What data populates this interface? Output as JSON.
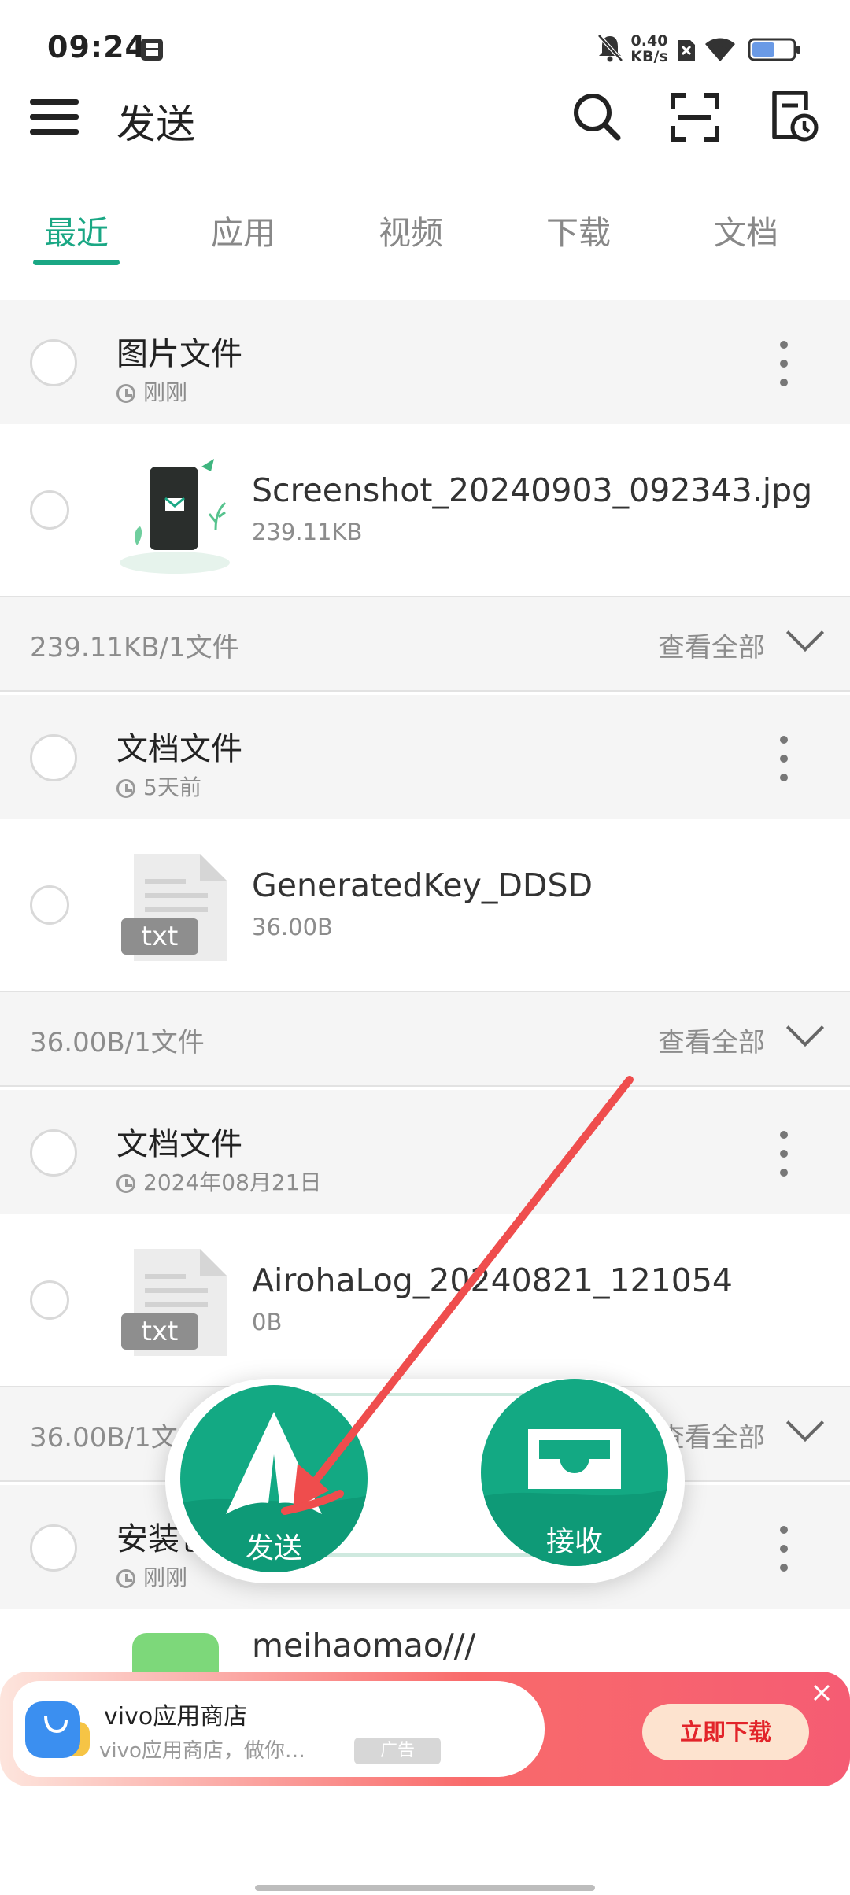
{
  "status_bar": {
    "time": "09:24",
    "net_speed_value": "0.40",
    "net_speed_unit": "KB/s",
    "icons": [
      "sim-icon",
      "mute-bell-icon",
      "no-sim-icon",
      "wifi-icon",
      "battery-icon"
    ]
  },
  "header": {
    "title": "发送",
    "icons": [
      "menu-icon",
      "search-icon",
      "scan-icon",
      "history-icon"
    ]
  },
  "tabs": [
    {
      "label": "最近",
      "active": true
    },
    {
      "label": "应用",
      "active": false
    },
    {
      "label": "视频",
      "active": false
    },
    {
      "label": "下载",
      "active": false
    },
    {
      "label": "文档",
      "active": false
    }
  ],
  "groups": [
    {
      "title": "图片文件",
      "time": "刚刚",
      "file": {
        "name": "Screenshot_20240903_092343.jpg",
        "size": "239.11KB",
        "thumb": "image-thumbnail"
      },
      "summary": "239.11KB/1文件",
      "view_all": "查看全部"
    },
    {
      "title": "文档文件",
      "time": "5天前",
      "file": {
        "name": "GeneratedKey_DDSD",
        "size": "36.00B",
        "badge": "txt"
      },
      "summary": "36.00B/1文件",
      "view_all": "查看全部"
    },
    {
      "title": "文档文件",
      "time": "2024年08月21日",
      "file": {
        "name": "AirohaLog_20240821_121054",
        "size": "0B",
        "badge": "txt"
      },
      "summary": "36.00B/1文件",
      "view_all": "查看全部"
    },
    {
      "title": "安装包",
      "time": "刚刚",
      "file": {
        "name": "meihaomao///",
        "size": ""
      }
    }
  ],
  "fab": {
    "send_label": "发送",
    "receive_label": "接收",
    "accent": "#13a983"
  },
  "ad": {
    "title": "vivo应用商店",
    "description": "vivo应用商店，做你…",
    "tag": "广告",
    "cta": "立即下载",
    "icon": "app-store-icon"
  },
  "colors": {
    "accent": "#1aa784",
    "arrow_annotation": "#ef4d4d"
  }
}
